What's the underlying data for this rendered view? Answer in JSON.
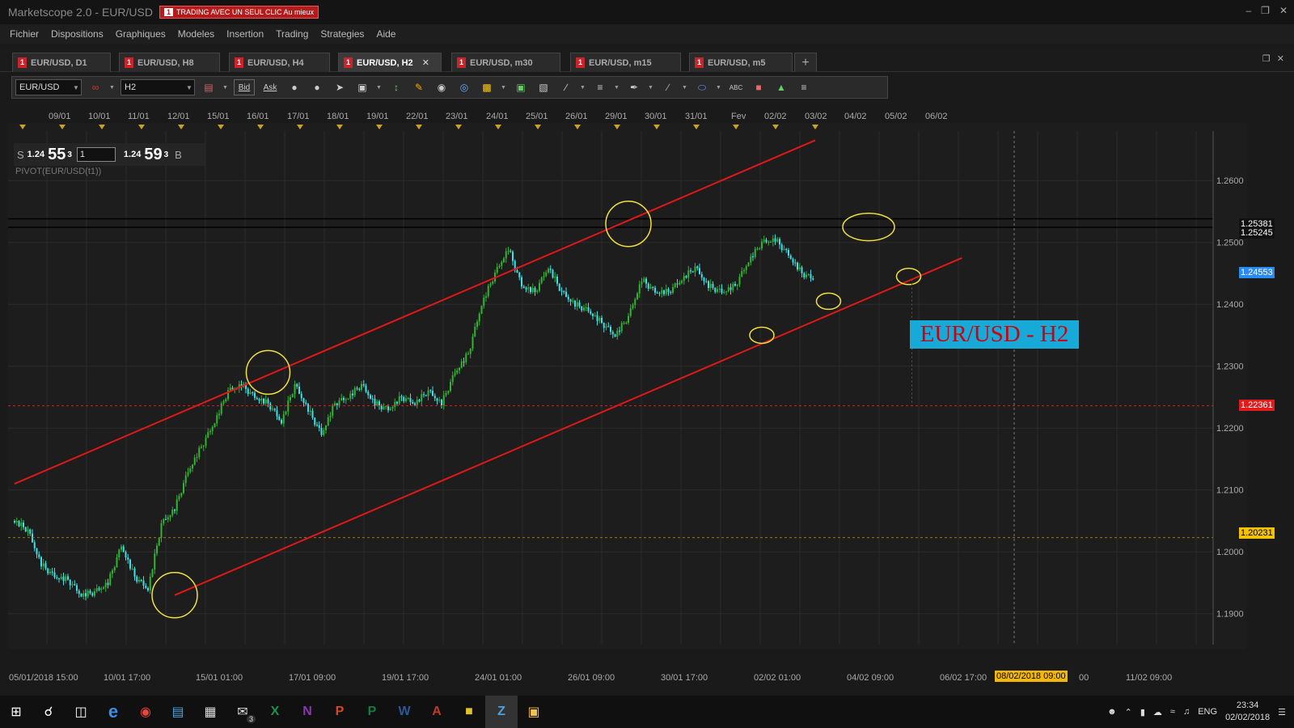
{
  "window": {
    "title": "Marketscope 2.0 - EUR/USD",
    "badge_num": "1",
    "badge_text": "TRADING AVEC UN SEUL CLIC Au mieux"
  },
  "menu": [
    "Fichier",
    "Dispositions",
    "Graphiques",
    "Modeles",
    "Insertion",
    "Trading",
    "Strategies",
    "Aide"
  ],
  "tabs": [
    {
      "label": "EUR/USD, D1",
      "active": false
    },
    {
      "label": "EUR/USD, H8",
      "active": false
    },
    {
      "label": "EUR/USD, H4",
      "active": false
    },
    {
      "label": "EUR/USD, H2",
      "active": true
    },
    {
      "label": "EUR/USD, m30",
      "active": false
    },
    {
      "label": "EUR/USD, m15",
      "active": false
    },
    {
      "label": "EUR/USD, m5",
      "active": false
    }
  ],
  "tab_add": "+",
  "toolbar": {
    "instrument": "EUR/USD",
    "timeframe": "H2",
    "bid": "Bid",
    "ask": "Ask"
  },
  "quote": {
    "sell_label": "S",
    "sell_small": "1.24",
    "sell_big": "55",
    "sell_sup": "3",
    "qty": "1",
    "buy_small": "1.24",
    "buy_big": "59",
    "buy_sup": "3",
    "buy_label": "B"
  },
  "indicator_label": "PIVOT(EUR/USD(t1))",
  "annotation": "EUR/USD - H2",
  "top_dates": [
    "09/01",
    "10/01",
    "11/01",
    "12/01",
    "15/01",
    "16/01",
    "17/01",
    "18/01",
    "19/01",
    "22/01",
    "23/01",
    "24/01",
    "25/01",
    "26/01",
    "29/01",
    "30/01",
    "31/01",
    "Fev",
    "02/02",
    "03/02",
    "04/02",
    "05/02",
    "06/02"
  ],
  "bottom_dates": [
    "05/01/2018 15:00",
    "10/01 17:00",
    "15/01 01:00",
    "17/01 09:00",
    "19/01 17:00",
    "24/01 01:00",
    "26/01 09:00",
    "30/01 17:00",
    "02/02 01:00",
    "04/02 09:00",
    "06/02 17:00",
    "00",
    "11/02 09:00"
  ],
  "cursor_date": "08/02/2018 09:00",
  "price_axis": [
    "1.2600",
    "1.2500",
    "1.2400",
    "1.2300",
    "1.2200",
    "1.2100",
    "1.2000",
    "1.1900"
  ],
  "price_labels": [
    {
      "text": "1.25381",
      "bg": "#111111",
      "fg": "#ffffff"
    },
    {
      "text": "1.25245",
      "bg": "#111111",
      "fg": "#ffffff"
    },
    {
      "text": "1.24553",
      "bg": "#2a8bf2",
      "fg": "#ffffff"
    },
    {
      "text": "1.22361",
      "bg": "#e11a1a",
      "fg": "#ffffff"
    },
    {
      "text": "1.20231",
      "bg": "#f3c200",
      "fg": "#000000"
    }
  ],
  "chart_data": {
    "type": "candlestick",
    "instrument": "EUR/USD",
    "timeframe": "H2",
    "ylim": [
      1.185,
      1.268
    ],
    "yticks": [
      1.19,
      1.2,
      1.21,
      1.22,
      1.23,
      1.24,
      1.25,
      1.26
    ],
    "close_path": [
      1.205,
      1.2035,
      1.198,
      1.196,
      1.1955,
      1.193,
      1.1935,
      1.195,
      1.201,
      1.196,
      1.194,
      1.2045,
      1.207,
      1.213,
      1.217,
      1.221,
      1.226,
      1.227,
      1.225,
      1.224,
      1.221,
      1.227,
      1.223,
      1.219,
      1.224,
      1.225,
      1.227,
      1.224,
      1.223,
      1.225,
      1.224,
      1.226,
      1.224,
      1.229,
      1.232,
      1.24,
      1.245,
      1.249,
      1.243,
      1.242,
      1.246,
      1.242,
      1.24,
      1.239,
      1.237,
      1.235,
      1.238,
      1.244,
      1.242,
      1.242,
      1.244,
      1.246,
      1.243,
      1.242,
      1.243,
      1.247,
      1.25,
      1.2505,
      1.248,
      1.245,
      1.244
    ],
    "channel_upper": {
      "start": [
        0,
        1.211
      ],
      "end": [
        60,
        1.2665
      ]
    },
    "channel_lower": {
      "start": [
        12,
        1.193
      ],
      "end": [
        71,
        1.2475
      ]
    },
    "hlines": [
      1.25381,
      1.25245,
      1.22361,
      1.20231
    ]
  },
  "taskbar": {
    "lang": "ENG",
    "time": "23:34",
    "date": "02/02/2018",
    "notif": "3"
  }
}
